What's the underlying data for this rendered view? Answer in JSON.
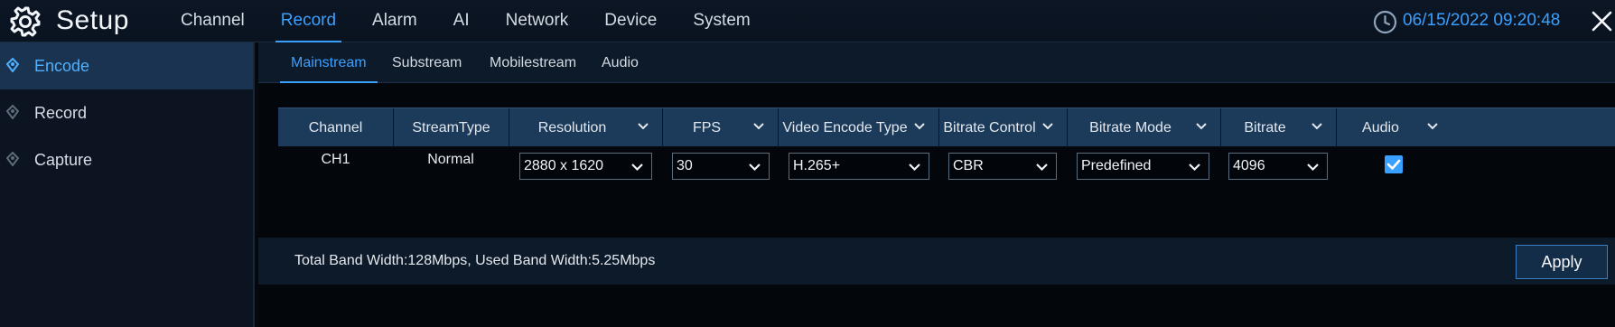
{
  "app": {
    "title": "Setup"
  },
  "nav": [
    "Channel",
    "Record",
    "Alarm",
    "AI",
    "Network",
    "Device",
    "System"
  ],
  "nav_active": "Record",
  "datetime": "06/15/2022 09:20:48",
  "sidebar": {
    "items": [
      {
        "label": "Encode",
        "active": true
      },
      {
        "label": "Record",
        "active": false
      },
      {
        "label": "Capture",
        "active": false
      }
    ]
  },
  "subtabs": [
    "Mainstream",
    "Substream",
    "Mobilestream",
    "Audio"
  ],
  "subtab_active": "Mainstream",
  "table": {
    "headers": [
      "Channel",
      "StreamType",
      "Resolution",
      "FPS",
      "Video Encode Type",
      "Bitrate Control",
      "Bitrate Mode",
      "Bitrate",
      "Audio"
    ],
    "row": {
      "channel": "CH1",
      "stream_type": "Normal",
      "resolution": "2880 x 1620",
      "fps": "30",
      "video_encode_type": "H.265+",
      "bitrate_control": "CBR",
      "bitrate_mode": "Predefined",
      "bitrate": "4096",
      "audio_checked": true
    }
  },
  "footer": {
    "bandwidth_text": "Total Band Width:128Mbps, Used Band Width:5.25Mbps",
    "apply_label": "Apply"
  },
  "colors": {
    "accent": "#3aa0ff",
    "header_bg": "#1c3a59",
    "sidebar_active_bg": "#1a3350"
  },
  "icons": {
    "settings": "gear-icon",
    "clock": "clock-icon",
    "close": "close-icon",
    "sidebar_marker": "location-pin-icon",
    "dropdown": "chevron-down-icon",
    "checked": "checkmark-icon"
  }
}
